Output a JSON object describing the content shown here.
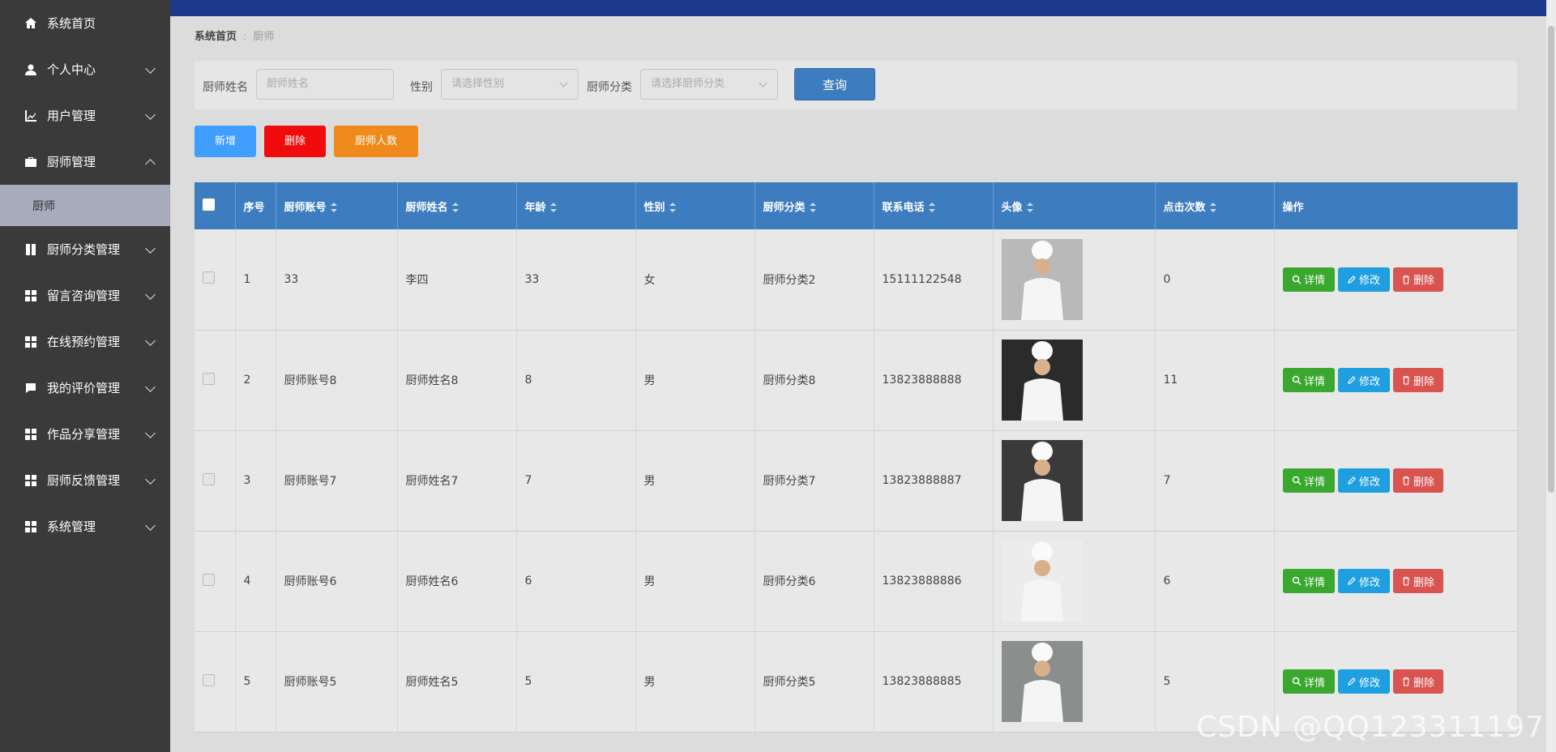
{
  "sidebar": {
    "items": [
      {
        "label": "系统首页",
        "icon": "home-icon"
      },
      {
        "label": "个人中心",
        "icon": "user-icon"
      },
      {
        "label": "用户管理",
        "icon": "chart-icon"
      },
      {
        "label": "厨师管理",
        "icon": "briefcase-icon",
        "expanded": true
      },
      {
        "label": "厨师",
        "sub": true
      },
      {
        "label": "厨师分类管理",
        "icon": "book-icon"
      },
      {
        "label": "留言咨询管理",
        "icon": "grid-icon"
      },
      {
        "label": "在线预约管理",
        "icon": "grid-icon"
      },
      {
        "label": "我的评价管理",
        "icon": "message-icon"
      },
      {
        "label": "作品分享管理",
        "icon": "grid-icon"
      },
      {
        "label": "厨师反馈管理",
        "icon": "grid-icon"
      },
      {
        "label": "系统管理",
        "icon": "grid-icon"
      }
    ]
  },
  "breadcrumb": {
    "home": "系统首页",
    "sep": ":",
    "current": "厨师"
  },
  "search": {
    "name_label": "厨师姓名",
    "name_placeholder": "厨师姓名",
    "gender_label": "性别",
    "gender_placeholder": "请选择性别",
    "category_label": "厨师分类",
    "category_placeholder": "请选择厨师分类",
    "query_label": "查询"
  },
  "actions": {
    "add": "新增",
    "delete": "删除",
    "count": "厨师人数"
  },
  "colors": {
    "add": "#409eff",
    "delete": "#f00c0c",
    "count": "#f08a1d",
    "header": "#3d7dbf"
  },
  "table": {
    "headers": [
      "序号",
      "厨师账号",
      "厨师姓名",
      "年龄",
      "性别",
      "厨师分类",
      "联系电话",
      "头像",
      "点击次数",
      "操作"
    ],
    "rows": [
      {
        "no": "1",
        "account": "33",
        "name": "李四",
        "age": "33",
        "gender": "女",
        "category": "厨师分类2",
        "phone": "15111122548",
        "clicks": "0"
      },
      {
        "no": "2",
        "account": "厨师账号8",
        "name": "厨师姓名8",
        "age": "8",
        "gender": "男",
        "category": "厨师分类8",
        "phone": "13823888888",
        "clicks": "11"
      },
      {
        "no": "3",
        "account": "厨师账号7",
        "name": "厨师姓名7",
        "age": "7",
        "gender": "男",
        "category": "厨师分类7",
        "phone": "13823888887",
        "clicks": "7"
      },
      {
        "no": "4",
        "account": "厨师账号6",
        "name": "厨师姓名6",
        "age": "6",
        "gender": "男",
        "category": "厨师分类6",
        "phone": "13823888886",
        "clicks": "6"
      },
      {
        "no": "5",
        "account": "厨师账号5",
        "name": "厨师姓名5",
        "age": "5",
        "gender": "男",
        "category": "厨师分类5",
        "phone": "13823888885",
        "clicks": "5"
      }
    ],
    "op_detail": "详情",
    "op_edit": "修改",
    "op_delete": "删除"
  },
  "watermark": "CSDN @QQ123311197"
}
